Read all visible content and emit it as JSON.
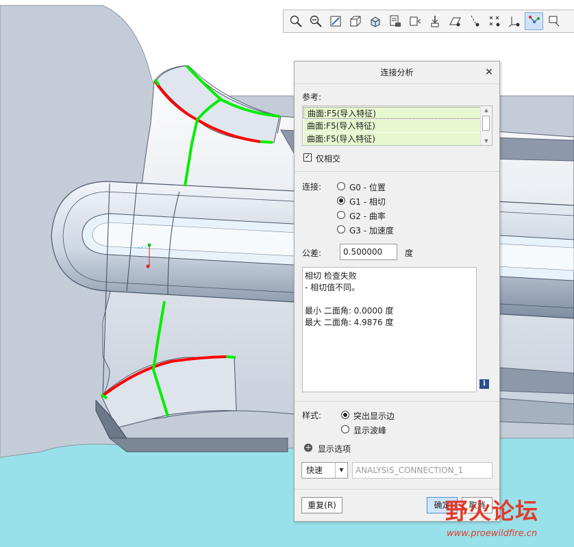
{
  "toolbar": {
    "icons": [
      "zoom-in-icon",
      "zoom-out-icon",
      "refit-icon",
      "named-views-icon",
      "perspective-icon",
      "saved-orientations-icon",
      "view-manager-icon",
      "spin-center-icon",
      "plane-display-icon",
      "axis-display-icon",
      "point-display-icon",
      "csys-display-icon",
      "annotation-display-icon",
      "more-icon"
    ],
    "active_index": 12
  },
  "dialog": {
    "title": "连接分析",
    "reference_label": "参考:",
    "references": [
      "曲面:F5(导入特征)",
      "曲面:F5(导入特征)",
      "曲面:F5(导入特征)"
    ],
    "intersect_only_label": "仅相交",
    "intersect_only_checked": true,
    "connection_label": "连接:",
    "connection_options": [
      "G0 - 位置",
      "G1 - 相切",
      "G2 - 曲率",
      "G3 - 加速度"
    ],
    "connection_selected": 1,
    "tolerance_label": "公差:",
    "tolerance_value": "0.500000",
    "tolerance_unit": "度",
    "result_text": "相切 检查失败\n- 相切值不同。\n\n最小 二面角: 0.0000 度\n最大 二面角: 4.9876 度",
    "info_icon": "i",
    "style_label": "样式:",
    "style_options": [
      "突出显示边",
      "显示波峰"
    ],
    "style_selected": 0,
    "display_options_label": "显示选项",
    "mode_value": "快速",
    "name_value": "ANALYSIS_CONNECTION_1",
    "reset_button": "重复(R)",
    "ok_button": "确定",
    "cancel_button": "取消"
  },
  "watermark": {
    "text": "野火论坛",
    "url": "www.proewildfire.cn"
  },
  "colors": {
    "background_top": "#ffffff",
    "background_bottom": "#8fdfea",
    "part_surface": "#c9d3e0",
    "highlight_red": "#ff0000",
    "highlight_green": "#00ee00"
  }
}
